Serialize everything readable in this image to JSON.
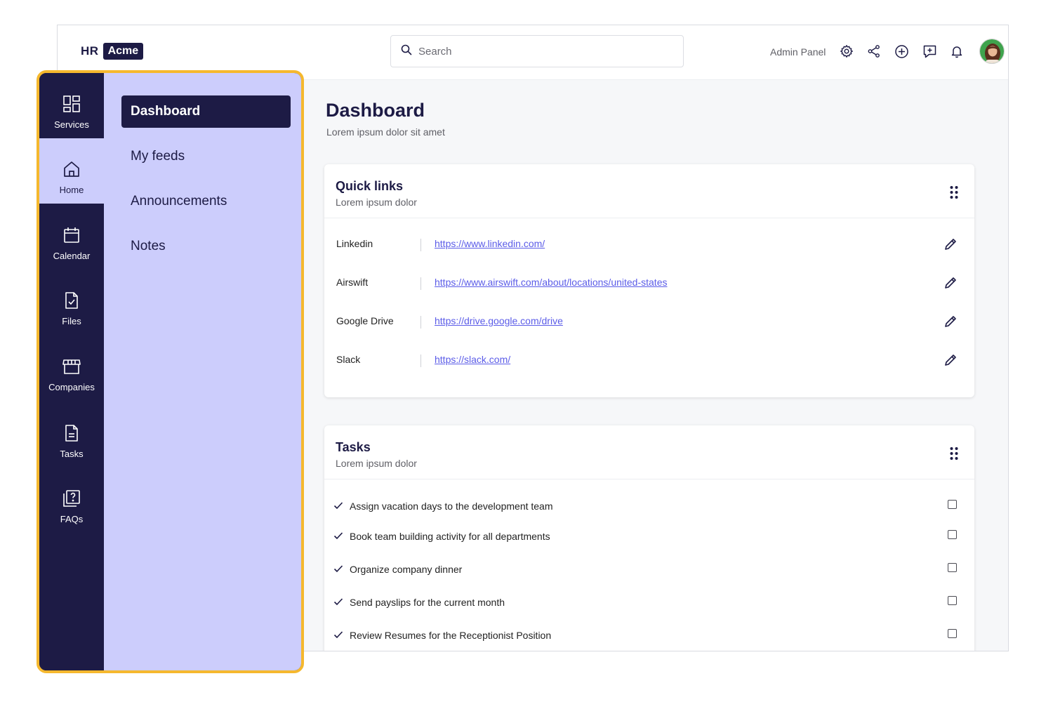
{
  "header": {
    "logo_hr": "HR",
    "logo_acme": "Acme",
    "search_placeholder": "Search",
    "admin_label": "Admin Panel",
    "icons": [
      "gear-icon",
      "share-icon",
      "plus-circle-icon",
      "message-plus-icon",
      "bell-icon"
    ]
  },
  "rail": {
    "items": [
      {
        "label": "Services",
        "icon": "grid-icon",
        "active": false
      },
      {
        "label": "Home",
        "icon": "home-icon",
        "active": true
      },
      {
        "label": "Calendar",
        "icon": "calendar-icon",
        "active": false
      },
      {
        "label": "Files",
        "icon": "file-check-icon",
        "active": false
      },
      {
        "label": "Companies",
        "icon": "store-icon",
        "active": false
      },
      {
        "label": "Tasks",
        "icon": "document-icon",
        "active": false
      },
      {
        "label": "FAQs",
        "icon": "question-icon",
        "active": false
      }
    ]
  },
  "subnav": {
    "items": [
      {
        "label": "Dashboard",
        "active": true
      },
      {
        "label": "My feeds",
        "active": false
      },
      {
        "label": "Announcements",
        "active": false
      },
      {
        "label": "Notes",
        "active": false
      }
    ]
  },
  "page": {
    "title": "Dashboard",
    "subtitle": "Lorem ipsum dolor sit amet"
  },
  "quick_links": {
    "title": "Quick links",
    "subtitle": "Lorem ipsum dolor",
    "rows": [
      {
        "name": "Linkedin",
        "url": "https://www.linkedin.com/"
      },
      {
        "name": "Airswift",
        "url": "https://www.airswift.com/about/locations/united-states"
      },
      {
        "name": "Google Drive",
        "url": "https://drive.google.com/drive"
      },
      {
        "name": "Slack",
        "url": "https://slack.com/"
      }
    ]
  },
  "tasks": {
    "title": "Tasks",
    "subtitle": "Lorem ipsum dolor",
    "rows": [
      {
        "text": "Assign vacation days to the development team",
        "checked": false
      },
      {
        "text": "Book team building activity for all departments",
        "checked": false
      },
      {
        "text": "Organize company dinner",
        "checked": false
      },
      {
        "text": "Send payslips for the current month",
        "checked": false
      },
      {
        "text": "Review Resumes for the Receptionist Position",
        "checked": false
      }
    ]
  },
  "colors": {
    "navy": "#1d1b45",
    "lavender": "#cccdfc",
    "highlight": "#f5b82e",
    "link": "#5b5ce8"
  }
}
